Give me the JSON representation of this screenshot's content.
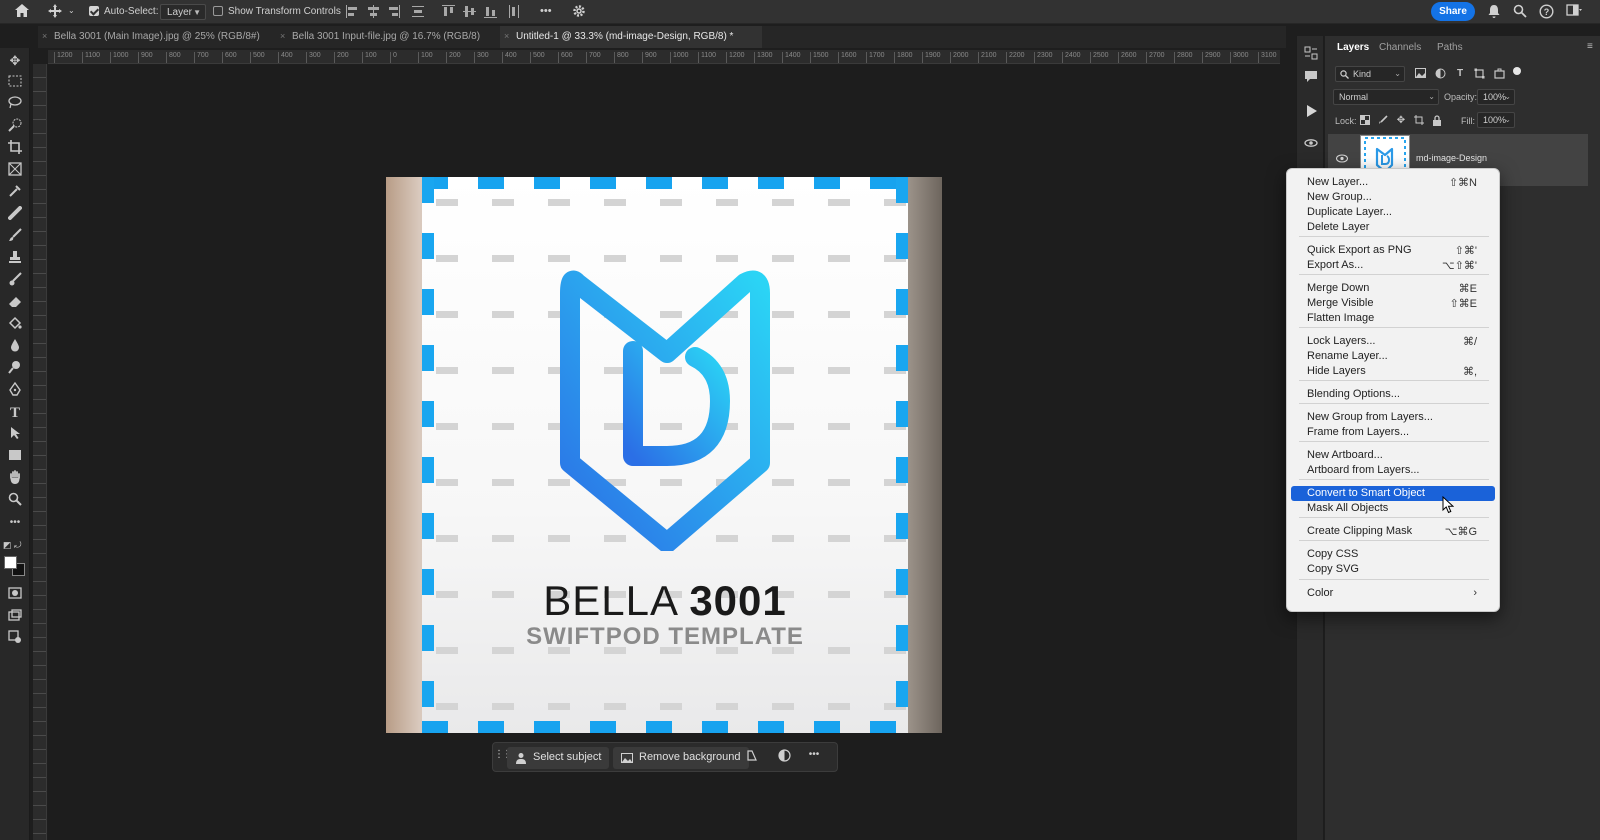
{
  "options_bar": {
    "auto_select_label": "Auto-Select:",
    "auto_select_checked": true,
    "auto_select_target": "Layer",
    "show_transform_label": "Show Transform Controls",
    "show_transform_checked": false,
    "more_label": "•••",
    "share_label": "Share"
  },
  "tabs": [
    {
      "label": "Bella 3001 (Main Image).jpg @ 25% (RGB/8#)",
      "active": false
    },
    {
      "label": "Bella 3001 Input-file.jpg @ 16.7% (RGB/8)",
      "active": false
    },
    {
      "label": "Untitled-1 @ 33.3% (md-image-Design, RGB/8) *",
      "active": true
    }
  ],
  "ruler_ticks": [
    "1200",
    "1100",
    "1000",
    "900",
    "800",
    "700",
    "600",
    "500",
    "400",
    "300",
    "200",
    "100",
    "0",
    "100",
    "200",
    "300",
    "400",
    "500",
    "600",
    "700",
    "800",
    "900",
    "1000",
    "1100",
    "1200",
    "1300",
    "1400",
    "1500",
    "1600",
    "1700",
    "1800",
    "1900",
    "2000",
    "2100",
    "2200",
    "2300",
    "2400",
    "2500",
    "2600",
    "2700",
    "2800",
    "2900",
    "3000",
    "3100"
  ],
  "document": {
    "brand_line1_light": "BELLA ",
    "brand_line1_bold": "3001",
    "brand_line2": "SWIFTPOD TEMPLATE"
  },
  "taskbar": {
    "select_subject": "Select subject",
    "remove_background": "Remove background",
    "more_label": "•••"
  },
  "panel": {
    "tabs": [
      "Layers",
      "Channels",
      "Paths"
    ],
    "active_tab": "Layers",
    "filter_kind": "Kind",
    "blend_mode": "Normal",
    "opacity_label": "Opacity:",
    "opacity_value": "100%",
    "lock_label": "Lock:",
    "fill_label": "Fill:",
    "fill_value": "100%",
    "layer_name": "md-image-Design"
  },
  "context_menu": {
    "items": [
      {
        "label": "New Layer...",
        "shortcut": "⇧⌘N"
      },
      {
        "label": "New Group...",
        "shortcut": ""
      },
      {
        "label": "Duplicate Layer...",
        "shortcut": ""
      },
      {
        "label": "Delete Layer",
        "shortcut": ""
      },
      {
        "label": "Quick Export as PNG",
        "shortcut": "⇧⌘'"
      },
      {
        "label": "Export As...",
        "shortcut": "⌥⇧⌘'"
      },
      {
        "label": "Merge Down",
        "shortcut": "⌘E"
      },
      {
        "label": "Merge Visible",
        "shortcut": "⇧⌘E"
      },
      {
        "label": "Flatten Image",
        "shortcut": ""
      },
      {
        "label": "Lock Layers...",
        "shortcut": "⌘/"
      },
      {
        "label": "Rename Layer...",
        "shortcut": ""
      },
      {
        "label": "Hide Layers",
        "shortcut": "⌘,"
      },
      {
        "label": "Blending Options...",
        "shortcut": ""
      },
      {
        "label": "New Group from Layers...",
        "shortcut": ""
      },
      {
        "label": "Frame from Layers...",
        "shortcut": ""
      },
      {
        "label": "New Artboard...",
        "shortcut": ""
      },
      {
        "label": "Artboard from Layers...",
        "shortcut": ""
      },
      {
        "label": "Convert to Smart Object",
        "shortcut": "",
        "highlighted": true
      },
      {
        "label": "Mask All Objects",
        "shortcut": ""
      },
      {
        "label": "Create Clipping Mask",
        "shortcut": "⌥⌘G"
      },
      {
        "label": "Copy CSS",
        "shortcut": ""
      },
      {
        "label": "Copy SVG",
        "shortcut": ""
      },
      {
        "label": "Color",
        "shortcut": "›"
      }
    ]
  },
  "colors": {
    "accent_blue": "#1473e6",
    "menu_highlight": "#1a62d9",
    "logo_gradient_start": "#2bd4f5",
    "logo_gradient_end": "#2b6fe6",
    "border_dash": "#17a3ef"
  }
}
